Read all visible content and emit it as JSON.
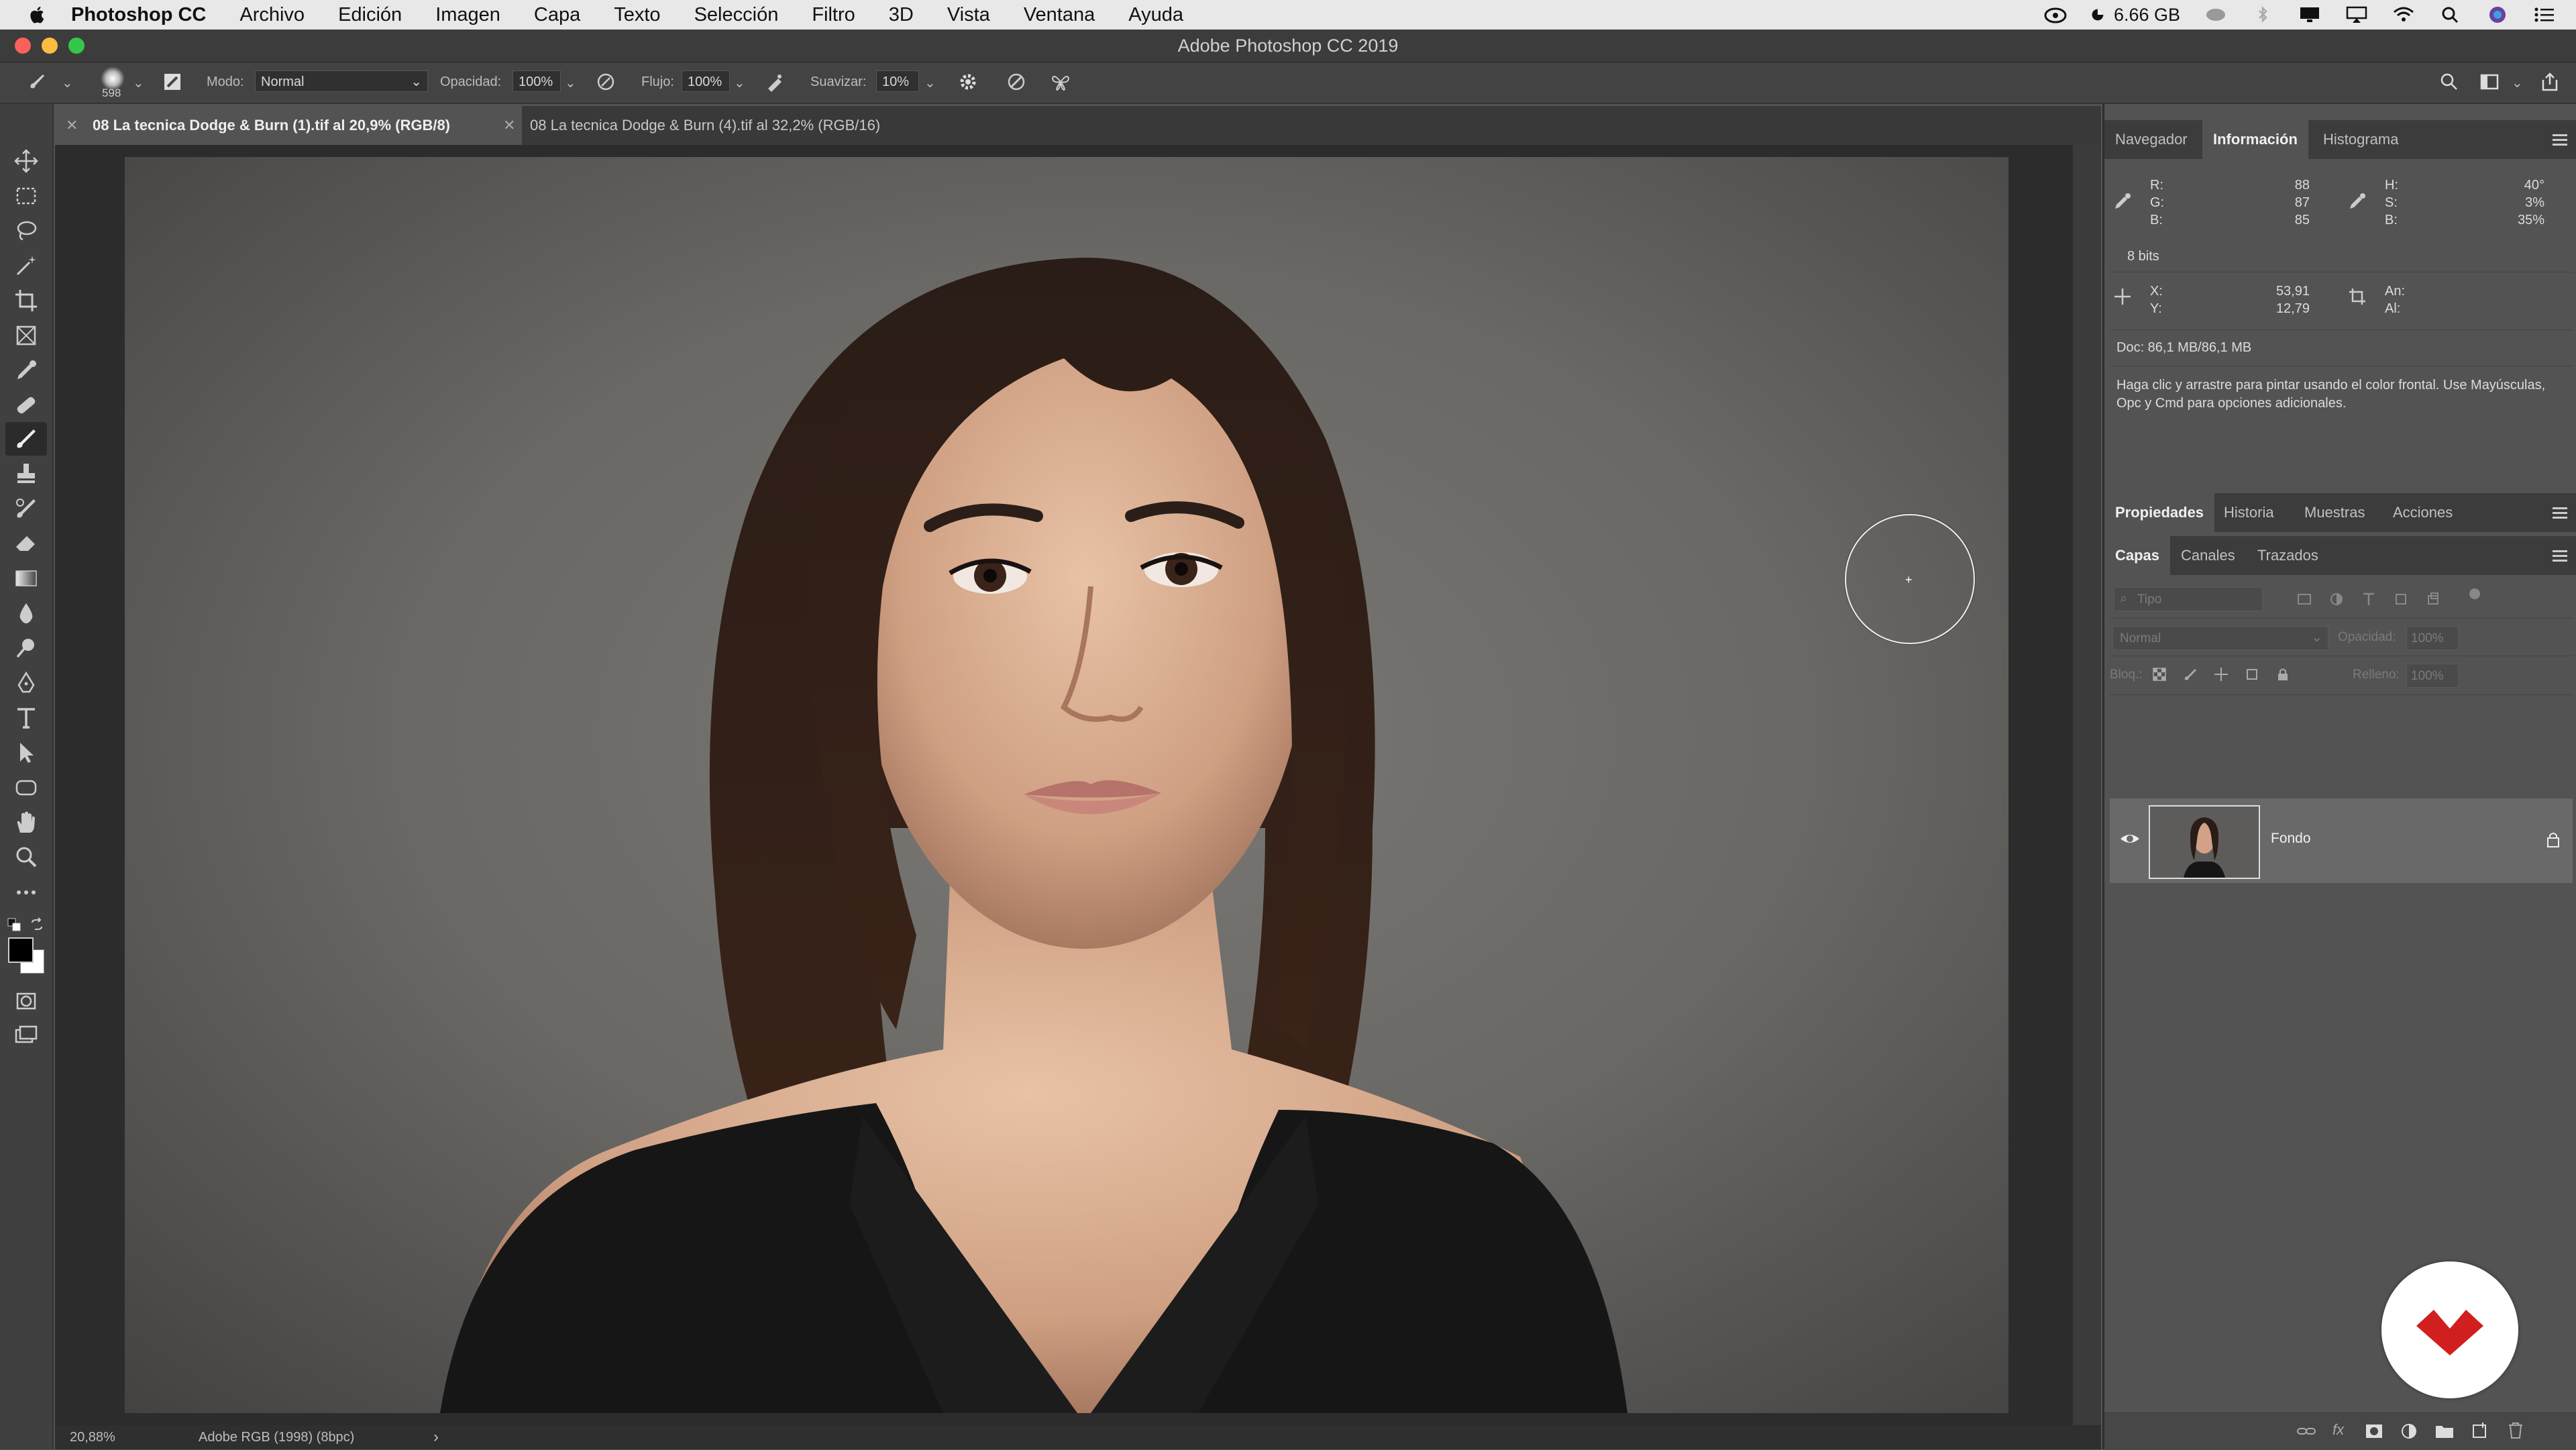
{
  "menubar": {
    "app": "Photoshop CC",
    "items": [
      "Archivo",
      "Edición",
      "Imagen",
      "Capa",
      "Texto",
      "Selección",
      "Filtro",
      "3D",
      "Vista",
      "Ventana",
      "Ayuda"
    ],
    "memory": "6.66 GB"
  },
  "window": {
    "title": "Adobe Photoshop CC 2019"
  },
  "options": {
    "brush_size": "598",
    "mode_label": "Modo:",
    "mode_value": "Normal",
    "opacity_label": "Opacidad:",
    "opacity_value": "100%",
    "flow_label": "Flujo:",
    "flow_value": "100%",
    "smooth_label": "Suavizar:",
    "smooth_value": "10%"
  },
  "tabs": [
    {
      "label": "08 La tecnica Dodge & Burn (1).tif al 20,9% (RGB/8)"
    },
    {
      "label": "08 La tecnica Dodge & Burn (4).tif al 32,2% (RGB/16)"
    }
  ],
  "status": {
    "zoom": "20,88%",
    "profile": "Adobe RGB (1998) (8bpc)",
    "arrow": "›"
  },
  "info_panel": {
    "tabs": [
      "Navegador",
      "Información",
      "Histograma"
    ],
    "r_label": "R:",
    "r": "88",
    "g_label": "G:",
    "g": "87",
    "b_label": "B:",
    "b": "85",
    "h_label": "H:",
    "h": "40°",
    "s_label": "S:",
    "s": "3%",
    "b2_label": "B:",
    "b2": "35%",
    "bits": "8 bits",
    "x_label": "X:",
    "x": "53,91",
    "y_label": "Y:",
    "y": "12,79",
    "w_label": "An:",
    "h2_label": "Al:",
    "doc": "Doc: 86,1 MB/86,1 MB",
    "hint": "Haga clic y arrastre para pintar usando el color frontal. Use Mayúsculas, Opc y Cmd para opciones adicionales."
  },
  "props_panel": {
    "tabs": [
      "Propiedades",
      "Historia",
      "Muestras",
      "Acciones"
    ]
  },
  "layers_panel": {
    "tabs": [
      "Capas",
      "Canales",
      "Trazados"
    ],
    "filter_placeholder": "Tipo",
    "blend": "Normal",
    "opacity_label": "Opacidad:",
    "opacity_value": "100%",
    "lock_label": "Bloq.:",
    "fill_label": "Relleno:",
    "fill_value": "100%",
    "layer_name": "Fondo",
    "bottom_icons": [
      "link-icon",
      "fx-icon",
      "mask-icon",
      "adjustment-icon",
      "folder-icon",
      "new-layer-icon",
      "trash-icon"
    ]
  },
  "colors": {
    "accent_red": "#d11f1f",
    "ui_bg": "#535353",
    "panel_dark": "#3c3c3c"
  }
}
